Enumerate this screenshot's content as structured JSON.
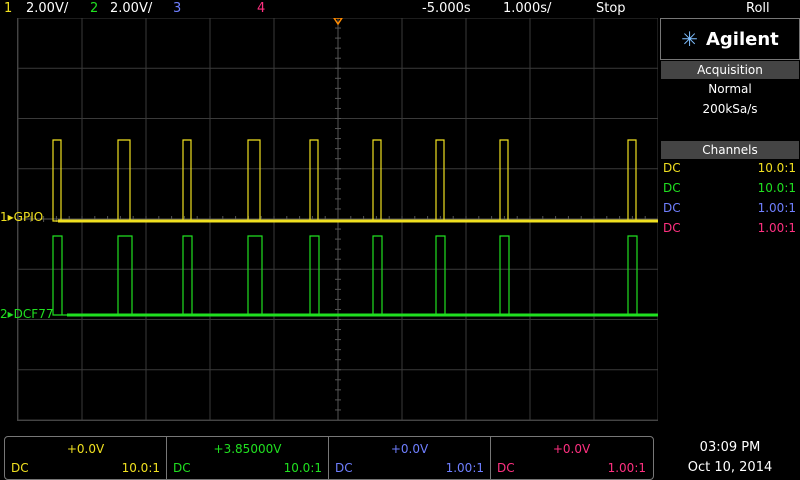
{
  "top": {
    "ch1_num": "1",
    "ch1_scale": "2.00V/",
    "ch2_num": "2",
    "ch2_scale": "2.00V/",
    "ch3_num": "3",
    "ch4_num": "4",
    "delay": "-5.000s",
    "timebase": "1.000s/",
    "run_state": "Stop",
    "mode": "Roll"
  },
  "brand": "Agilent",
  "acquisition": {
    "header": "Acquisition",
    "mode": "Normal",
    "rate": "200kSa/s"
  },
  "channels": {
    "header": "Channels",
    "rows": [
      {
        "coupling": "DC",
        "probe": "10.0:1",
        "color": "#f0e020"
      },
      {
        "coupling": "DC",
        "probe": "10.0:1",
        "color": "#20e020"
      },
      {
        "coupling": "DC",
        "probe": "1.00:1",
        "color": "#6f7fff"
      },
      {
        "coupling": "DC",
        "probe": "1.00:1",
        "color": "#ff3080"
      }
    ]
  },
  "markers": {
    "ch1": "GPIO",
    "ch1_num": "1",
    "ch2": "DCF77",
    "ch2_num": "2"
  },
  "bottom": [
    {
      "offset": "+0.0V",
      "coupling": "DC",
      "probe": "10.0:1",
      "color": "#f0e020"
    },
    {
      "offset": "+3.85000V",
      "coupling": "DC",
      "probe": "10.0:1",
      "color": "#20e020"
    },
    {
      "offset": "+0.0V",
      "coupling": "DC",
      "probe": "1.00:1",
      "color": "#6f7fff"
    },
    {
      "offset": "+0.0V",
      "coupling": "DC",
      "probe": "1.00:1",
      "color": "#ff3080"
    }
  ],
  "clock": {
    "time": "03:09 PM",
    "date": "Oct 10, 2014"
  },
  "traces": {
    "ch1_color": "#f0e020",
    "ch2_color": "#20e020",
    "pulse_starts": [
      35,
      100,
      165,
      230,
      292,
      355,
      418,
      482,
      610
    ],
    "ch1_pulse_widths": [
      8,
      12,
      8,
      12,
      8,
      8,
      8,
      8,
      8
    ],
    "ch2_pulse_widths": [
      9,
      14,
      9,
      14,
      9,
      9,
      9,
      9,
      9
    ]
  }
}
